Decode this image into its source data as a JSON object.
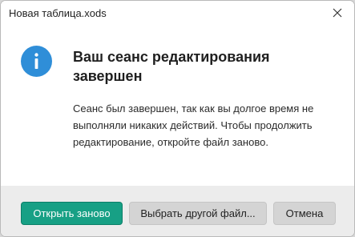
{
  "window": {
    "title": "Новая таблица.xods",
    "close_icon": "close-icon"
  },
  "dialog": {
    "icon": "info-icon",
    "icon_color": "#2f8ed8",
    "heading": "Ваш сеанс редактирования завершен",
    "message": "Сеанс был завершен, так как вы долгое время не выполняли никаких действий. Чтобы продолжить редактирование, откройте файл заново."
  },
  "buttons": {
    "reopen_label": "Открыть заново",
    "browse_label": "Выбрать другой файл...",
    "cancel_label": "Отмена",
    "primary_color": "#17a085"
  }
}
